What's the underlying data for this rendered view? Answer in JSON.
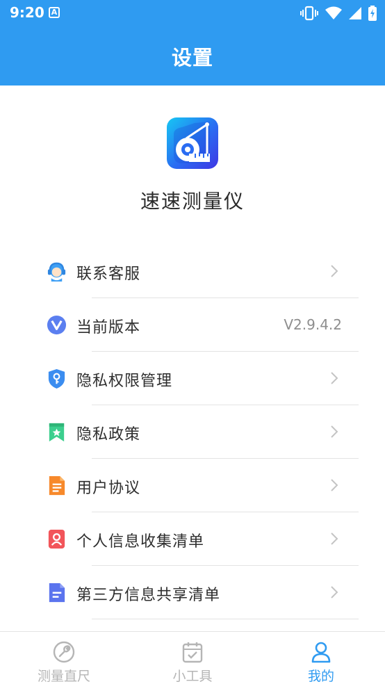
{
  "status_bar": {
    "time": "9:20",
    "notification_glyph": "A",
    "icons": [
      "vibrate-icon",
      "wifi-icon",
      "signal-icon",
      "battery-charging-icon"
    ]
  },
  "header": {
    "title": "设置"
  },
  "app": {
    "name": "速速测量仪",
    "logo_icon": "tape-measure-icon"
  },
  "menu": {
    "items": [
      {
        "label": "联系客服",
        "icon": "customer-service-icon",
        "value": "",
        "chevron": true
      },
      {
        "label": "当前版本",
        "icon": "version-icon",
        "value": "V2.9.4.2",
        "chevron": false
      },
      {
        "label": "隐私权限管理",
        "icon": "shield-key-icon",
        "value": "",
        "chevron": true
      },
      {
        "label": "隐私政策",
        "icon": "bookmark-star-icon",
        "value": "",
        "chevron": true
      },
      {
        "label": "用户协议",
        "icon": "document-icon",
        "value": "",
        "chevron": true
      },
      {
        "label": "个人信息收集清单",
        "icon": "user-card-icon",
        "value": "",
        "chevron": true
      },
      {
        "label": "第三方信息共享清单",
        "icon": "file-list-icon",
        "value": "",
        "chevron": true
      }
    ]
  },
  "tabbar": {
    "tabs": [
      {
        "label": "测量直尺",
        "icon": "wrench-icon",
        "active": false
      },
      {
        "label": "小工具",
        "icon": "calendar-check-icon",
        "active": false
      },
      {
        "label": "我的",
        "icon": "person-icon",
        "active": true
      }
    ]
  },
  "colors": {
    "primary": "#2f9bf1",
    "tab_inactive": "#b5b5b5",
    "text": "#2e2e2e",
    "divider": "#e3e3e3"
  }
}
